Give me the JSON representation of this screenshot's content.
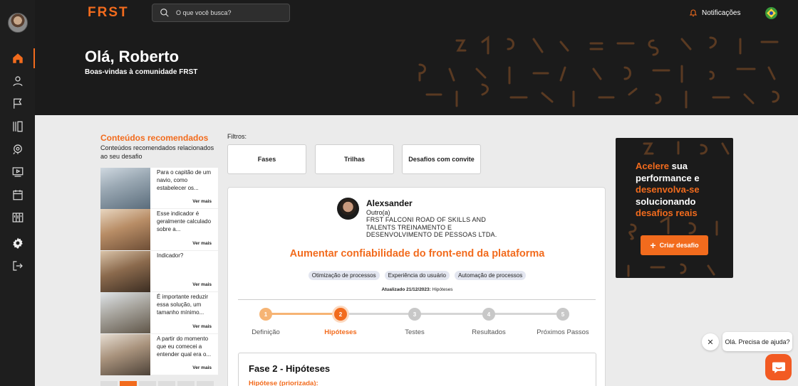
{
  "brand": {
    "logo": "FRST",
    "accent": "#f26b1d"
  },
  "search": {
    "placeholder": "O que você busca?"
  },
  "topbar": {
    "notifications_label": "Notificações"
  },
  "hero": {
    "title": "Olá, Roberto",
    "subtitle": "Boas-vindas à comunidade FRST"
  },
  "sidebar": {
    "items": [
      {
        "icon": "home-icon",
        "active": true
      },
      {
        "icon": "user-icon"
      },
      {
        "icon": "flag-icon"
      },
      {
        "icon": "library-icon"
      },
      {
        "icon": "rocket-icon"
      },
      {
        "icon": "video-icon"
      },
      {
        "icon": "calendar-icon"
      },
      {
        "icon": "kanban-icon"
      },
      {
        "icon": "gear-icon"
      },
      {
        "icon": "logout-icon"
      }
    ]
  },
  "recommended": {
    "title": "Conteúdos recomendados",
    "subtitle": "Conteúdos recomendados relacionados ao seu desafio",
    "items": [
      {
        "text": "Para o capitão de um navio, como estabelecer os...",
        "more": "Ver mais"
      },
      {
        "text": "Esse indicador é geralmente calculado sobre a...",
        "more": "Ver mais"
      },
      {
        "text": "Indicador?",
        "more": "Ver mais"
      },
      {
        "text": "É importante reduzir essa solução, um tamanho mínimo...",
        "more": "Ver mais"
      },
      {
        "text": "A partir do momento que eu comecei a entender qual era o...",
        "more": "Ver mais"
      }
    ]
  },
  "filters": {
    "label": "Filtros:",
    "buttons": [
      "Fases",
      "Trilhas",
      "Desafios com convite"
    ]
  },
  "challenge": {
    "author": "Alexsander",
    "role": "Outro(a)",
    "company": "FRST FALCONI ROAD OF SKILLS AND TALENTS TREINAMENTO E DESENVOLVIMENTO DE PESSOAS LTDA.",
    "title": "Aumentar confiabilidade do front-end da plataforma",
    "tags": [
      "Otimização de processos",
      "Experiência do usuário",
      "Automação de processos"
    ],
    "updated_prefix": "Atualizado 21/12/2023:",
    "updated_phase": "Hipóteses",
    "steps": [
      {
        "num": "1",
        "label": "Definição",
        "state": "done"
      },
      {
        "num": "2",
        "label": "Hipóteses",
        "state": "current"
      },
      {
        "num": "3",
        "label": "Testes",
        "state": "todo"
      },
      {
        "num": "4",
        "label": "Resultados",
        "state": "todo"
      },
      {
        "num": "5",
        "label": "Próximos Passos",
        "state": "todo"
      }
    ],
    "phase_title": "Fase 2 - Hipóteses",
    "phase_sub": "Hipótese (priorizada):"
  },
  "promo": {
    "line1_o": "Acelere",
    "line1_w": " sua performance e ",
    "line2_o": "desenvolva-se",
    "line3_w": " solucionando ",
    "line4_o": "desafios reais",
    "button": "Criar desafio"
  },
  "chat": {
    "close": "✕",
    "bubble": "Olá. Precisa de ajuda?"
  }
}
